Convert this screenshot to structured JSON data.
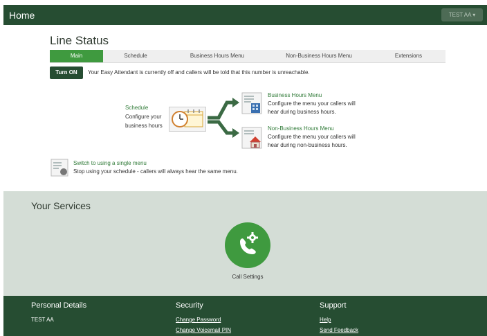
{
  "header": {
    "home": "Home",
    "user_menu": "TEST AA ▾"
  },
  "line_status": {
    "title": "Line Status",
    "tabs": [
      {
        "label": "Main",
        "active": true
      },
      {
        "label": "Schedule",
        "active": false
      },
      {
        "label": "Business Hours Menu",
        "active": false
      },
      {
        "label": "Non-Business Hours Menu",
        "active": false
      },
      {
        "label": "Extensions",
        "active": false
      }
    ],
    "turn_on_label": "Turn ON",
    "off_message": "Your Easy Attendant is currently off and callers will be told that this number is unreachable.",
    "schedule": {
      "link": "Schedule",
      "line1": "Configure your",
      "line2": "business hours"
    },
    "business_hours": {
      "link": "Business Hours Menu",
      "line1": "Configure the menu your callers will",
      "line2": "hear during business hours."
    },
    "non_business_hours": {
      "link": "Non-Business Hours Menu",
      "line1": "Configure the menu your callers will",
      "line2": "hear during non-business hours."
    },
    "single_menu": {
      "link": "Switch to using a single menu",
      "desc": "Stop using your schedule - callers will always hear the same menu."
    }
  },
  "services": {
    "title": "Your Services",
    "call_settings": "Call Settings"
  },
  "footer": {
    "personal": {
      "title": "Personal Details",
      "name": "TEST AA"
    },
    "security": {
      "title": "Security",
      "change_password": "Change Password",
      "change_pin": "Change Voicemail PIN"
    },
    "support": {
      "title": "Support",
      "help": "Help",
      "feedback": "Send Feedback"
    }
  },
  "colors": {
    "dark_green": "#264d32",
    "accent_green": "#3f9a3f",
    "services_bg": "#d4ddd6"
  }
}
